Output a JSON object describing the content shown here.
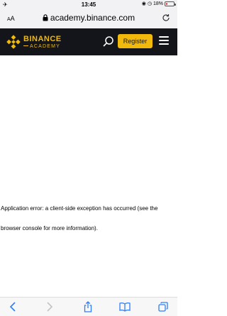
{
  "status_bar": {
    "left_icon": "airplane-icon",
    "time": "13:45",
    "battery_percent": "18%",
    "battery_level": 0.18,
    "battery_color": "#e23b3b"
  },
  "address_bar": {
    "text_size_label": "AA",
    "url": "academy.binance.com"
  },
  "header": {
    "brand_name": "BINANCE",
    "brand_sub": "ACADEMY",
    "register_label": "Register",
    "accent_color": "#f0b90b",
    "background_color": "#14151a"
  },
  "main": {
    "error_message": "Application error: a client-side exception has occurred (see the browser console for more information)."
  },
  "toolbar": {
    "icons": [
      "back-icon",
      "forward-icon",
      "share-icon",
      "bookmarks-icon",
      "tabs-icon"
    ]
  }
}
